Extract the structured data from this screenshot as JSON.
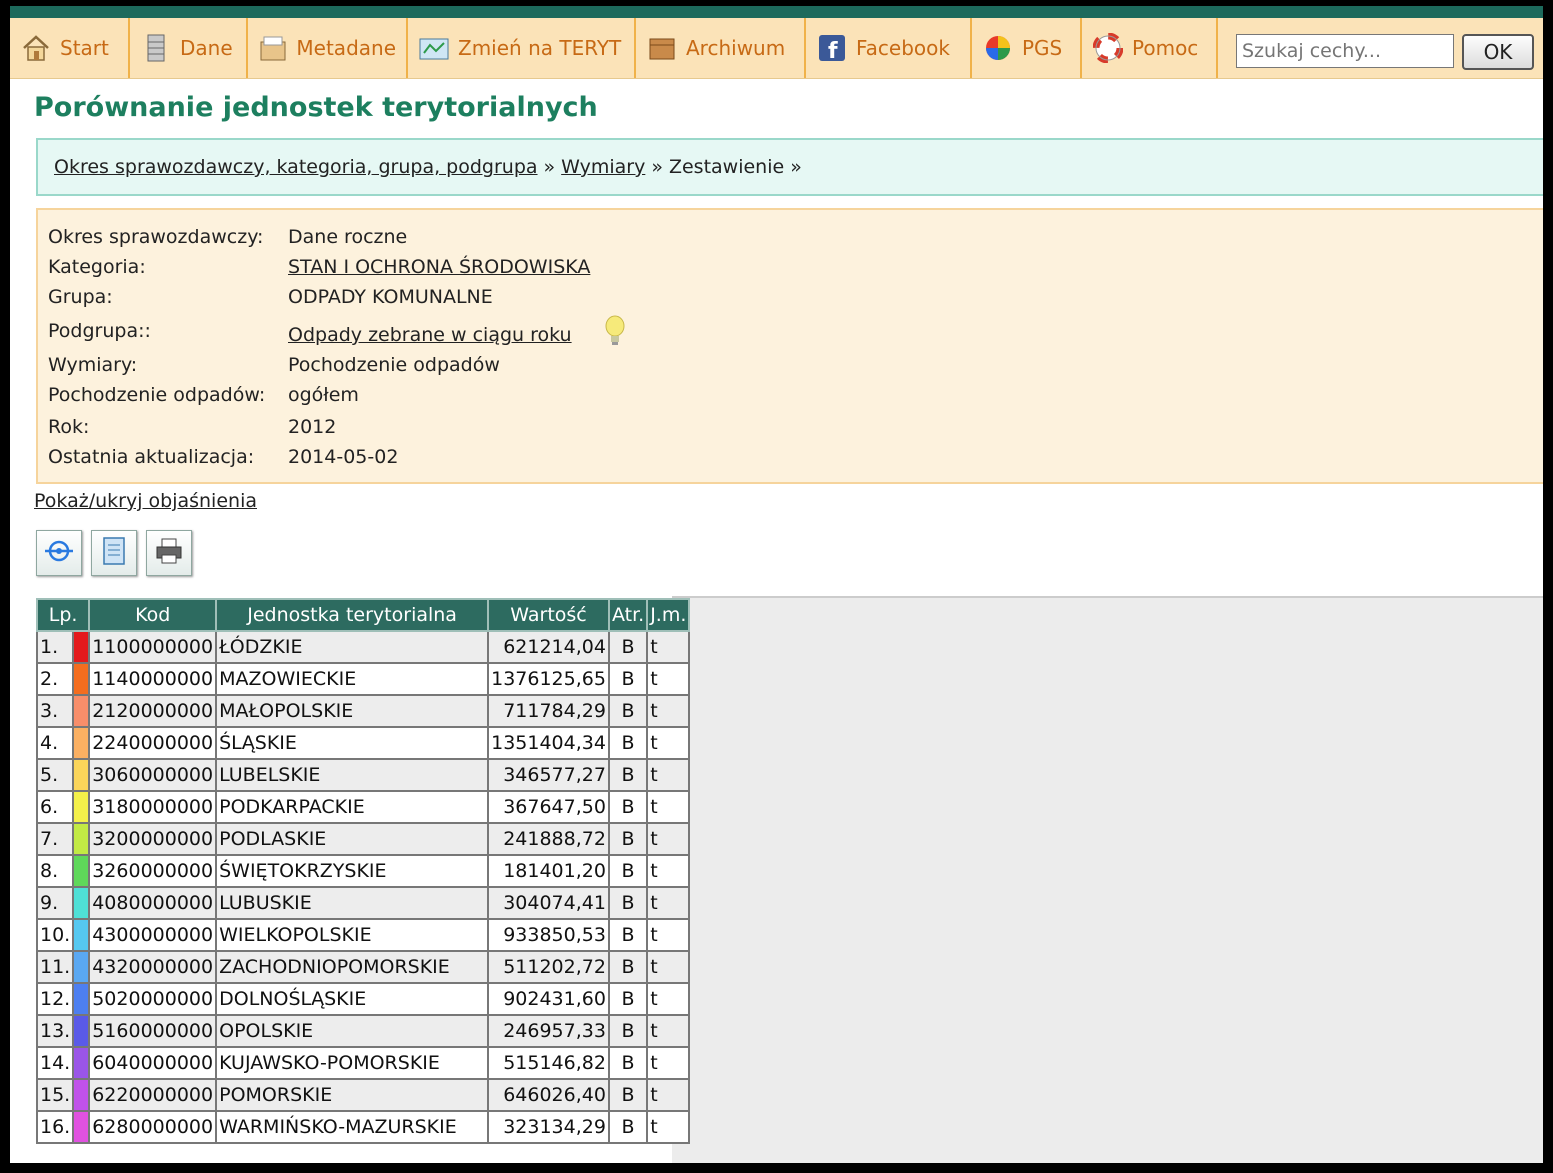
{
  "toolbar": {
    "items": [
      {
        "label": "Start",
        "icon": "home-icon"
      },
      {
        "label": "Dane",
        "icon": "database-icon"
      },
      {
        "label": "Metadane",
        "icon": "metadata-icon"
      },
      {
        "label": "Zmień na TERYT",
        "icon": "map-icon"
      },
      {
        "label": "Archiwum",
        "icon": "archive-icon"
      },
      {
        "label": "Facebook",
        "icon": "facebook-icon"
      },
      {
        "label": "PGS",
        "icon": "pgs-icon"
      },
      {
        "label": "Pomoc",
        "icon": "lifebuoy-icon"
      }
    ],
    "search_placeholder": "Szukaj cechy...",
    "ok_label": "OK"
  },
  "page_title": "Porównanie jednostek terytorialnych",
  "breadcrumb": {
    "link1": "Okres sprawozdawczy, kategoria, grupa, podgrupa",
    "link2": "Wymiary",
    "current": "Zestawienie",
    "separator": "»"
  },
  "info": {
    "okres": {
      "label": "Okres sprawozdawczy:",
      "value": "Dane roczne"
    },
    "kategoria": {
      "label": "Kategoria:",
      "value": "STAN I OCHRONA ŚRODOWISKA"
    },
    "grupa": {
      "label": "Grupa:",
      "value": "ODPADY KOMUNALNE"
    },
    "podgrupa": {
      "label": "Podgrupa::",
      "value": "Odpady zebrane w ciągu roku"
    },
    "wymiary": {
      "label": "Wymiary:",
      "value": "Pochodzenie odpadów"
    },
    "pochodzenie": {
      "label": "Pochodzenie odpadów:",
      "value": "ogółem"
    },
    "rok": {
      "label": "Rok:",
      "value": "2012"
    },
    "aktualizacja": {
      "label": "Ostatnia aktualizacja:",
      "value": "2014-05-02"
    }
  },
  "toggle_link": "Pokaż/ukryj objaśnienia",
  "tools": [
    "chart-icon",
    "document-icon",
    "print-icon"
  ],
  "table": {
    "headers": [
      "Lp.",
      "Kod",
      "Jednostka terytorialna",
      "Wartość",
      "Atr.",
      "J.m."
    ],
    "rows": [
      {
        "lp": "1.",
        "color": "#e31a1c",
        "kod": "1100000000",
        "name": "ŁÓDZKIE",
        "value": "621214,04",
        "atr": "B",
        "jm": "t"
      },
      {
        "lp": "2.",
        "color": "#f46d1f",
        "kod": "1140000000",
        "name": "MAZOWIECKIE",
        "value": "1376125,65",
        "atr": "B",
        "jm": "t"
      },
      {
        "lp": "3.",
        "color": "#f88e6a",
        "kod": "2120000000",
        "name": "MAŁOPOLSKIE",
        "value": "711784,29",
        "atr": "B",
        "jm": "t"
      },
      {
        "lp": "4.",
        "color": "#fbb062",
        "kod": "2240000000",
        "name": "ŚLĄSKIE",
        "value": "1351404,34",
        "atr": "B",
        "jm": "t"
      },
      {
        "lp": "5.",
        "color": "#fbd55a",
        "kod": "3060000000",
        "name": "LUBELSKIE",
        "value": "346577,27",
        "atr": "B",
        "jm": "t"
      },
      {
        "lp": "6.",
        "color": "#f4f04a",
        "kod": "3180000000",
        "name": "PODKARPACKIE",
        "value": "367647,50",
        "atr": "B",
        "jm": "t"
      },
      {
        "lp": "7.",
        "color": "#c2ea44",
        "kod": "3200000000",
        "name": "PODLASKIE",
        "value": "241888,72",
        "atr": "B",
        "jm": "t"
      },
      {
        "lp": "8.",
        "color": "#5fd85a",
        "kod": "3260000000",
        "name": "ŚWIĘTOKRZYSKIE",
        "value": "181401,20",
        "atr": "B",
        "jm": "t"
      },
      {
        "lp": "9.",
        "color": "#4fe0d6",
        "kod": "4080000000",
        "name": "LUBUSKIE",
        "value": "304074,41",
        "atr": "B",
        "jm": "t"
      },
      {
        "lp": "10.",
        "color": "#55c8f0",
        "kod": "4300000000",
        "name": "WIELKOPOLSKIE",
        "value": "933850,53",
        "atr": "B",
        "jm": "t"
      },
      {
        "lp": "11.",
        "color": "#5aa8f2",
        "kod": "4320000000",
        "name": "ZACHODNIOPOMORSKIE",
        "value": "511202,72",
        "atr": "B",
        "jm": "t"
      },
      {
        "lp": "12.",
        "color": "#4d7ff0",
        "kod": "5020000000",
        "name": "DOLNOŚLĄSKIE",
        "value": "902431,60",
        "atr": "B",
        "jm": "t"
      },
      {
        "lp": "13.",
        "color": "#5a5ae8",
        "kod": "5160000000",
        "name": "OPOLSKIE",
        "value": "246957,33",
        "atr": "B",
        "jm": "t"
      },
      {
        "lp": "14.",
        "color": "#9a55e8",
        "kod": "6040000000",
        "name": "KUJAWSKO-POMORSKIE",
        "value": "515146,82",
        "atr": "B",
        "jm": "t"
      },
      {
        "lp": "15.",
        "color": "#c052ea",
        "kod": "6220000000",
        "name": "POMORSKIE",
        "value": "646026,40",
        "atr": "B",
        "jm": "t"
      },
      {
        "lp": "16.",
        "color": "#e052e0",
        "kod": "6280000000",
        "name": "WARMIŃSKO-MAZURSKIE",
        "value": "323134,29",
        "atr": "B",
        "jm": "t"
      }
    ]
  }
}
